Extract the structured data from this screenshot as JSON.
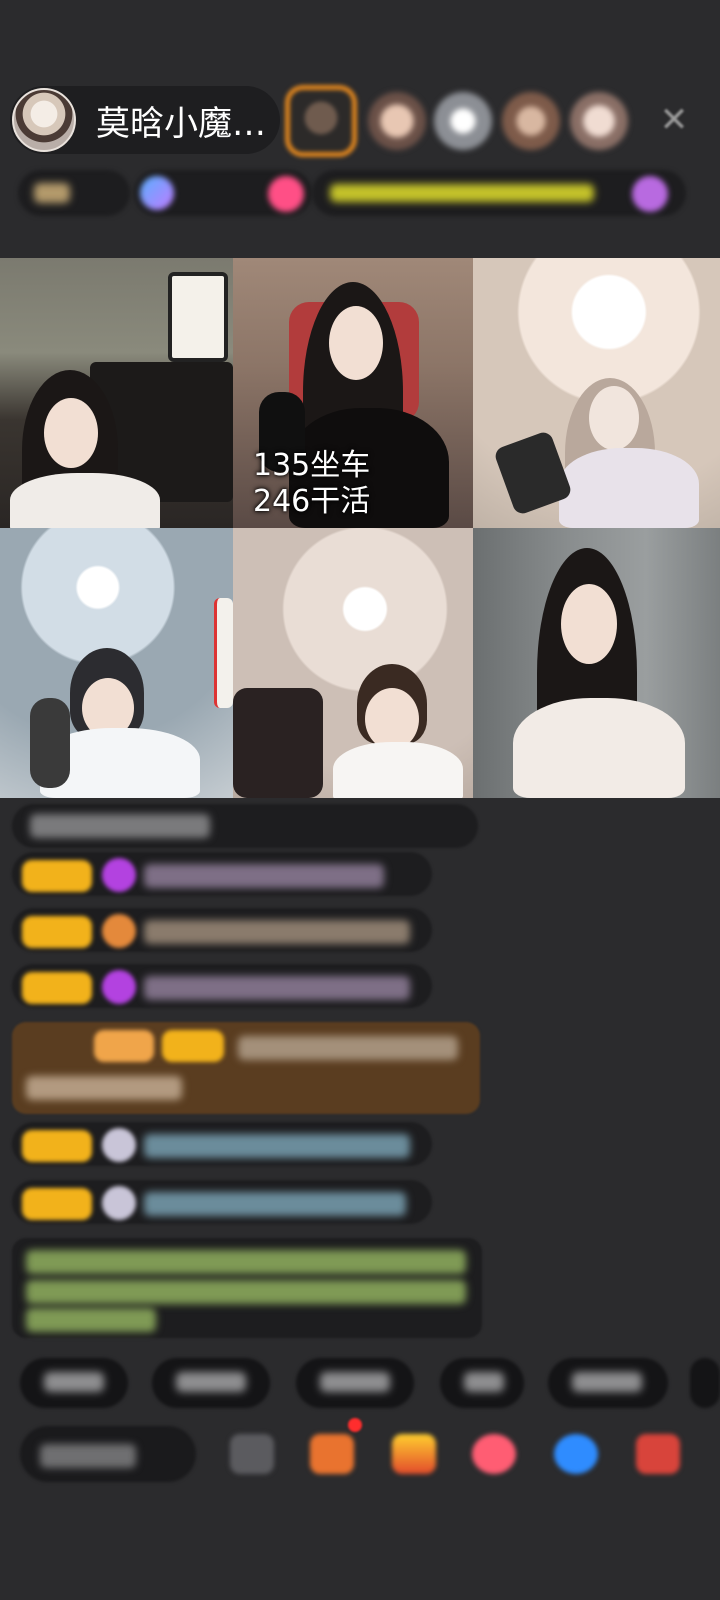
{
  "host": {
    "name": "莫晗小魔…",
    "avatar_icon": "host-avatar"
  },
  "header": {
    "close_icon": "close-icon",
    "close_glyph": "✕"
  },
  "video_tiles": [
    {
      "id": 1
    },
    {
      "id": 2,
      "overlay_lines": [
        "135坐车",
        "246干活"
      ]
    },
    {
      "id": 3
    },
    {
      "id": 4
    },
    {
      "id": 5
    },
    {
      "id": 6
    }
  ],
  "colors": {
    "background": "#2b2b2d",
    "badge": "#f2b21b",
    "highlight": "#5a3d20",
    "gift_pink": "#ff4f86"
  }
}
